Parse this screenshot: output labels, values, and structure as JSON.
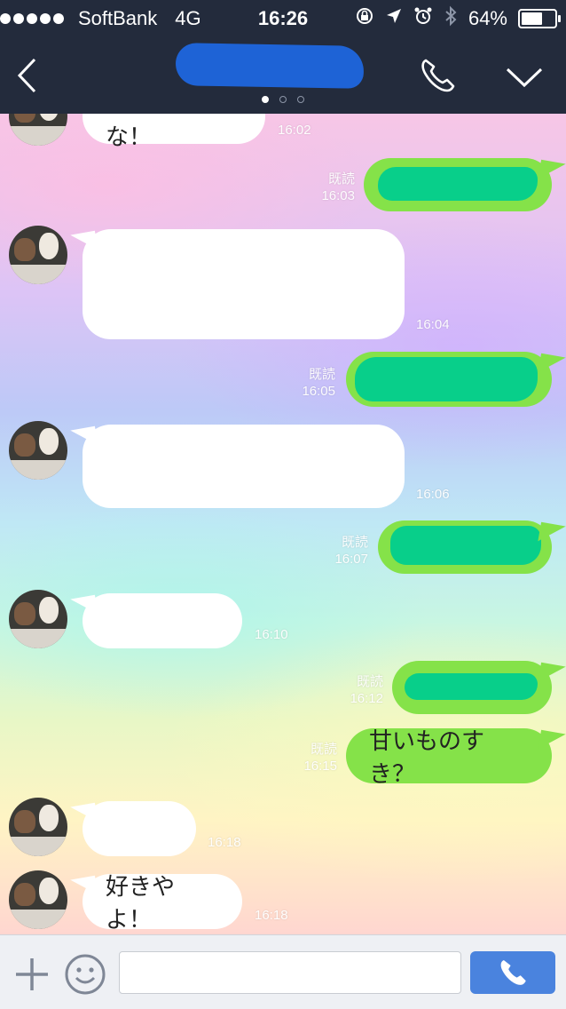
{
  "status_bar": {
    "carrier": "SoftBank",
    "network": "4G",
    "time": "16:26",
    "battery_percent": "64%",
    "battery_level": 0.64,
    "icons": [
      "signal-dots-icon",
      "rotation-lock-icon",
      "location-arrow-icon",
      "alarm-icon",
      "bluetooth-icon",
      "battery-icon"
    ]
  },
  "header": {
    "title_redacted": true,
    "page_count": 3,
    "active_page": 1,
    "icons": [
      "back-chevron-icon",
      "phone-icon",
      "chevron-down-icon"
    ]
  },
  "messages": [
    {
      "side": "in",
      "text": "よしやでな！",
      "time": "16:02",
      "read": ""
    },
    {
      "side": "out",
      "text": "",
      "time": "16:03",
      "read": "既読",
      "redacted": true
    },
    {
      "side": "in",
      "text": "",
      "time": "16:04",
      "read": ""
    },
    {
      "side": "out",
      "text": "",
      "time": "16:05",
      "read": "既読",
      "redacted": true
    },
    {
      "side": "in",
      "text": "",
      "time": "16:06",
      "read": ""
    },
    {
      "side": "out",
      "text": "",
      "time": "16:07",
      "read": "既読",
      "redacted": true
    },
    {
      "side": "in",
      "text": "",
      "time": "16:10",
      "read": ""
    },
    {
      "side": "out",
      "text": "",
      "time": "16:12",
      "read": "既読",
      "redacted": true
    },
    {
      "side": "out",
      "text": "甘いものすき？",
      "time": "16:15",
      "read": "既読"
    },
    {
      "side": "in",
      "text": "",
      "time": "16:18",
      "read": ""
    },
    {
      "side": "in",
      "text": "好きやよ！",
      "time": "16:18",
      "read": ""
    }
  ],
  "input_bar": {
    "placeholder": "",
    "value": "",
    "icons": [
      "plus-icon",
      "smiley-icon",
      "phone-icon"
    ]
  },
  "colors": {
    "header_bg": "#232b3c",
    "outgoing_bubble": "#85e249",
    "redaction_green": "#08cf8a",
    "redaction_blue": "#1e63d6",
    "send_button": "#4a83de"
  }
}
